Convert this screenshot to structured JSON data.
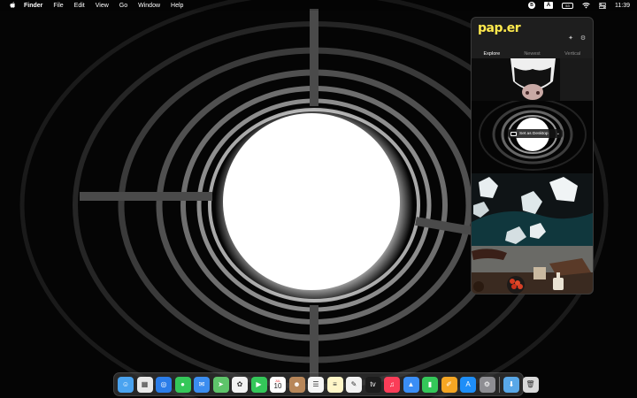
{
  "menubar": {
    "apple_icon": "apple-logo-icon",
    "app_name": "Finder",
    "menus": [
      "File",
      "Edit",
      "View",
      "Go",
      "Window",
      "Help"
    ],
    "status": {
      "extension_badge": "B",
      "input_source": "A",
      "battery": "53",
      "clock": "11:39"
    }
  },
  "popover": {
    "logo": "pap.er",
    "tabs": [
      {
        "label": "Explore",
        "active": true
      },
      {
        "label": "Newest",
        "active": false
      },
      {
        "label": "Vertical",
        "active": false
      }
    ],
    "set_desktop_label": "Set as Desktop"
  },
  "dock": {
    "calendar_day": "10",
    "calendar_month": "JUL",
    "apps": [
      {
        "name": "finder",
        "color": "#4aa3f0",
        "glyph": "☺"
      },
      {
        "name": "launchpad",
        "color": "#e9e9e9",
        "glyph": "▦"
      },
      {
        "name": "safari",
        "color": "#2b7de9",
        "glyph": "◎"
      },
      {
        "name": "messages",
        "color": "#34c759",
        "glyph": "●"
      },
      {
        "name": "mail",
        "color": "#3b8df0",
        "glyph": "✉"
      },
      {
        "name": "maps",
        "color": "#5ec46a",
        "glyph": "➤"
      },
      {
        "name": "photos",
        "color": "#f2f2f2",
        "glyph": "✿"
      },
      {
        "name": "facetime",
        "color": "#34c759",
        "glyph": "▶"
      },
      {
        "name": "calendar",
        "color": "#ffffff",
        "glyph": ""
      },
      {
        "name": "contacts",
        "color": "#b8875a",
        "glyph": "☻"
      },
      {
        "name": "reminders",
        "color": "#f5f5f5",
        "glyph": "☰"
      },
      {
        "name": "notes",
        "color": "#fff6c8",
        "glyph": "≡"
      },
      {
        "name": "freeform",
        "color": "#f2f2f2",
        "glyph": "✎"
      },
      {
        "name": "tv",
        "color": "#1c1c1c",
        "glyph": "tv"
      },
      {
        "name": "music",
        "color": "#fb3d58",
        "glyph": "♫"
      },
      {
        "name": "keynote",
        "color": "#3a8ef6",
        "glyph": "▲"
      },
      {
        "name": "numbers",
        "color": "#34c759",
        "glyph": "▮"
      },
      {
        "name": "pages",
        "color": "#f5a623",
        "glyph": "✐"
      },
      {
        "name": "app-store",
        "color": "#1e8ef8",
        "glyph": "A"
      },
      {
        "name": "system-settings",
        "color": "#8e8e93",
        "glyph": "⚙"
      }
    ],
    "right_items": [
      {
        "name": "downloads-folder",
        "color": "#59a8e8",
        "glyph": "⬇"
      },
      {
        "name": "trash",
        "color": "#d9d9d9",
        "glyph": "🗑"
      }
    ]
  }
}
